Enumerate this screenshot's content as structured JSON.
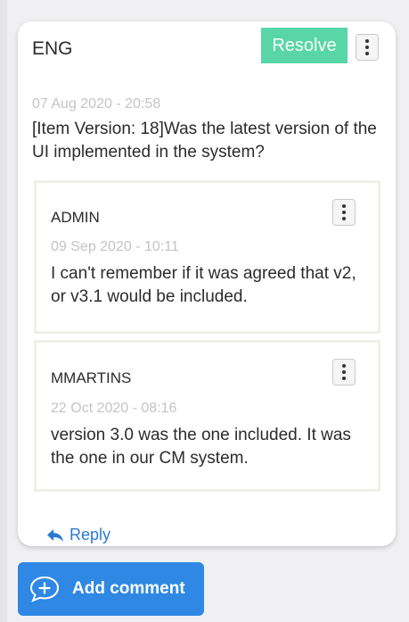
{
  "comment": {
    "author": "ENG",
    "resolve_label": "Resolve",
    "timestamp": "07 Aug 2020 - 20:58",
    "text": "[Item Version: 18]Was the latest version of the UI implemented in the system?"
  },
  "replies": [
    {
      "author": "ADMIN",
      "timestamp": "09 Sep 2020 - 10:11",
      "text": "I can't remember if it was agreed that v2, or v3.1 would be included."
    },
    {
      "author": "MMARTINS",
      "timestamp": "22 Oct 2020 - 08:16",
      "text": "version 3.0 was the one included. It was the one in our CM system."
    }
  ],
  "reply_link_label": "Reply",
  "add_comment_label": "Add comment",
  "icons": {
    "more": "more-vertical-icon",
    "reply": "reply-arrow-icon",
    "add": "chat-plus-icon"
  },
  "colors": {
    "resolve": "#58d6a7",
    "link": "#2a7bd4",
    "primary_button": "#2f88e3",
    "timestamp": "#c4c4c4"
  }
}
